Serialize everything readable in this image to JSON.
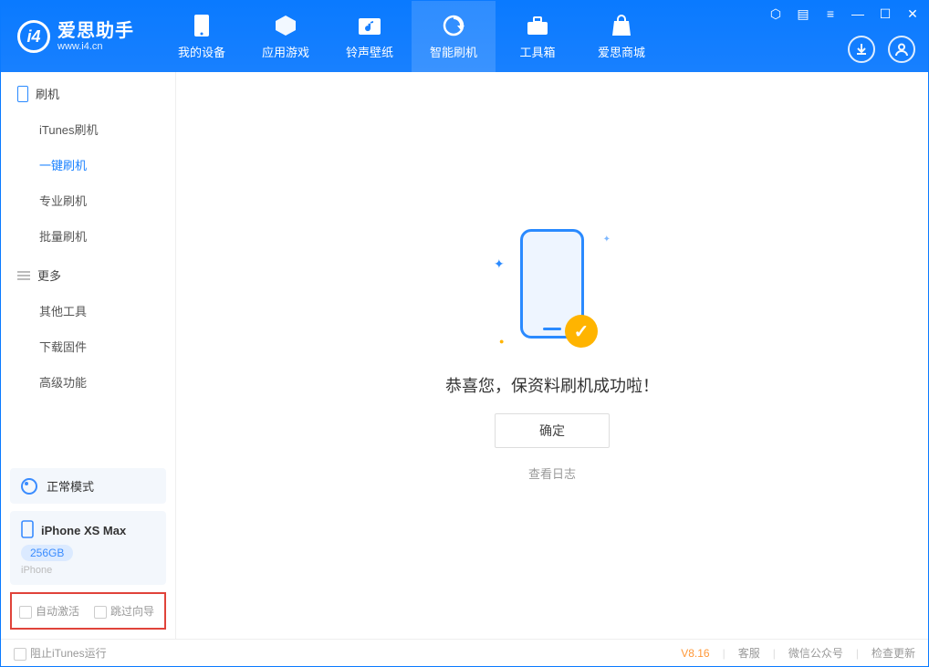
{
  "app": {
    "name": "爱思助手",
    "url": "www.i4.cn"
  },
  "tabs": {
    "device": "我的设备",
    "apps": "应用游戏",
    "ring": "铃声壁纸",
    "flash": "智能刷机",
    "tools": "工具箱",
    "store": "爱思商城"
  },
  "sidebar": {
    "sec1": "刷机",
    "items1": {
      "a": "iTunes刷机",
      "b": "一键刷机",
      "c": "专业刷机",
      "d": "批量刷机"
    },
    "sec2": "更多",
    "items2": {
      "a": "其他工具",
      "b": "下载固件",
      "c": "高级功能"
    },
    "mode": "正常模式",
    "device_name": "iPhone XS Max",
    "device_storage": "256GB",
    "device_type": "iPhone",
    "opt_auto": "自动激活",
    "opt_skip": "跳过向导"
  },
  "main": {
    "success": "恭喜您，保资料刷机成功啦！",
    "ok": "确定",
    "log": "查看日志"
  },
  "status": {
    "block_itunes": "阻止iTunes运行",
    "version": "V8.16",
    "s1": "客服",
    "s2": "微信公众号",
    "s3": "检查更新"
  }
}
